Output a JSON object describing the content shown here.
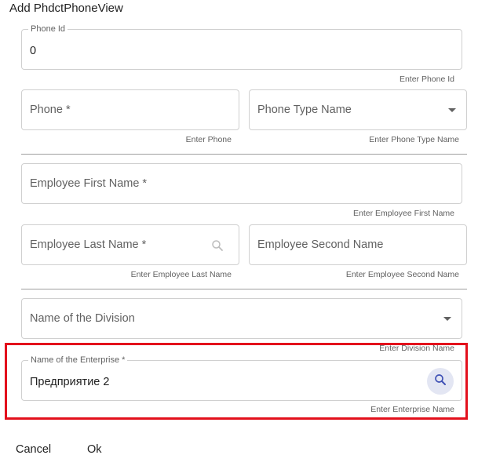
{
  "dialog": {
    "title": "Add PhdctPhoneView",
    "cancel_label": "Cancel",
    "ok_label": "Ok"
  },
  "fields": {
    "phone_id": {
      "label": "Phone Id",
      "value": "0",
      "hint": "Enter Phone Id"
    },
    "phone": {
      "placeholder": "Phone *",
      "hint": "Enter Phone"
    },
    "phone_type": {
      "placeholder": "Phone Type Name",
      "hint": "Enter Phone Type Name"
    },
    "employee_first": {
      "placeholder": "Employee First Name *",
      "hint": "Enter Employee First Name"
    },
    "employee_last": {
      "placeholder": "Employee Last Name *",
      "hint": "Enter Employee Last Name"
    },
    "employee_second": {
      "placeholder": "Employee Second Name",
      "hint": "Enter Employee Second Name"
    },
    "division": {
      "placeholder": "Name of the Division",
      "hint": "Enter Division Name"
    },
    "enterprise": {
      "label": "Name of the Enterprise *",
      "value": "Предприятие 2",
      "hint": "Enter Enterprise Name"
    }
  },
  "colors": {
    "highlight": "#e3101c",
    "search_button_bg": "#e3e6f3",
    "search_icon": "#3f51b5"
  }
}
